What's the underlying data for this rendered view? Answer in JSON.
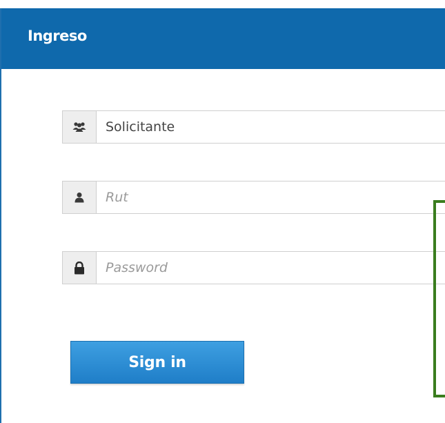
{
  "panel": {
    "title": "Ingreso",
    "header_color": "#0f69ac"
  },
  "form": {
    "user_type": {
      "selected_value": "Solicitante",
      "icon": "users-icon"
    },
    "rut": {
      "placeholder": "Rut",
      "icon": "user-icon"
    },
    "password": {
      "placeholder": "Password",
      "icon": "lock-icon"
    },
    "submit_label": "Sign in",
    "button_color": "#2a8ad6"
  },
  "annotation": {
    "highlight_color": "#3a7d1e"
  }
}
